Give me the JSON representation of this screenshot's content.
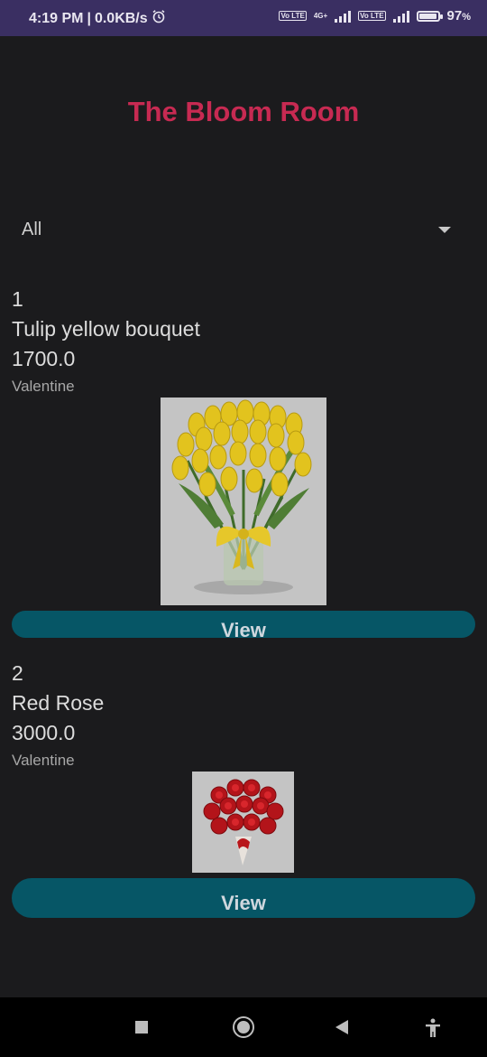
{
  "status_bar": {
    "time": "4:19 PM",
    "speed": "0.0KB/s",
    "volte1": "Vo LTE",
    "network": "4G+",
    "volte2": "Vo LTE",
    "battery": "97",
    "battery_unit": "%",
    "battery_level": 0.97
  },
  "app": {
    "title": "The Bloom Room"
  },
  "filter": {
    "selected": "All"
  },
  "items": [
    {
      "index": "1",
      "name": "Tulip yellow bouquet",
      "price": "1700.0",
      "category": "Valentine",
      "button_label": "View"
    },
    {
      "index": "2",
      "name": "Red Rose",
      "price": "3000.0",
      "category": "Valentine",
      "button_label": "View"
    }
  ],
  "icons": {
    "alarm": "alarm-icon",
    "signal": "signal-icon",
    "battery": "battery-icon",
    "recents": "recents-icon",
    "home": "home-icon",
    "back": "back-icon",
    "accessibility": "accessibility-icon"
  },
  "colors": {
    "status_bar": "#3a2f62",
    "background": "#1b1b1d",
    "title": "#c72a52",
    "button": "#065666"
  }
}
